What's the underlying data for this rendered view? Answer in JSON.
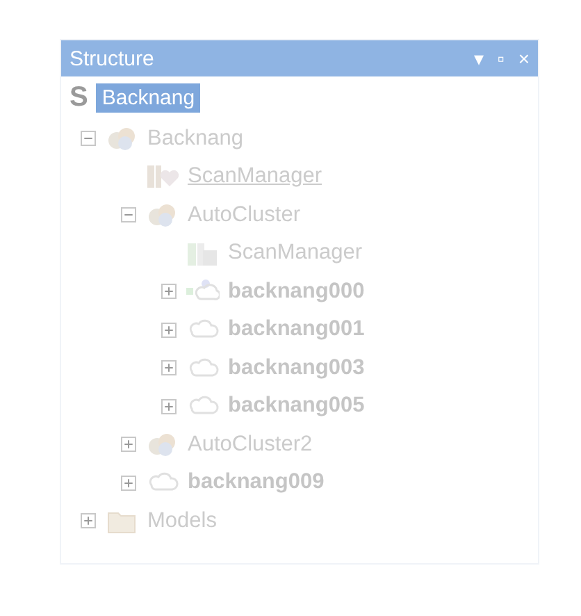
{
  "window": {
    "title": "Structure",
    "buttons": [
      "▾",
      "▫",
      "×"
    ]
  },
  "header": {
    "logo": "S",
    "title": "Backnang",
    "selected": true
  },
  "tree": [
    {
      "label": "Backnang",
      "kind": "group",
      "expanded": true,
      "bold": false,
      "underlined": false,
      "children": [
        {
          "label": "ScanManager",
          "kind": "manager",
          "bold": false,
          "underlined": true
        },
        {
          "label": "AutoCluster",
          "kind": "group",
          "expanded": true,
          "bold": false,
          "underlined": false,
          "children": [
            {
              "label": "ScanManager",
              "kind": "scanner",
              "bold": false,
              "underlined": false
            },
            {
              "label": "backnang000",
              "kind": "node-active",
              "expanded": false,
              "bold": true,
              "underlined": false
            },
            {
              "label": "backnang001",
              "kind": "node",
              "expanded": false,
              "bold": true,
              "underlined": false
            },
            {
              "label": "backnang003",
              "kind": "node",
              "expanded": false,
              "bold": true,
              "underlined": false
            },
            {
              "label": "backnang005",
              "kind": "node",
              "expanded": false,
              "bold": true,
              "underlined": false
            }
          ]
        },
        {
          "label": "AutoCluster2",
          "kind": "group",
          "expanded": false,
          "bold": false,
          "underlined": false
        },
        {
          "label": "backnang009",
          "kind": "node",
          "expanded": false,
          "bold": true,
          "underlined": false
        }
      ]
    },
    {
      "label": "Models",
      "kind": "folder",
      "expanded": false,
      "bold": false,
      "underlined": false
    }
  ]
}
